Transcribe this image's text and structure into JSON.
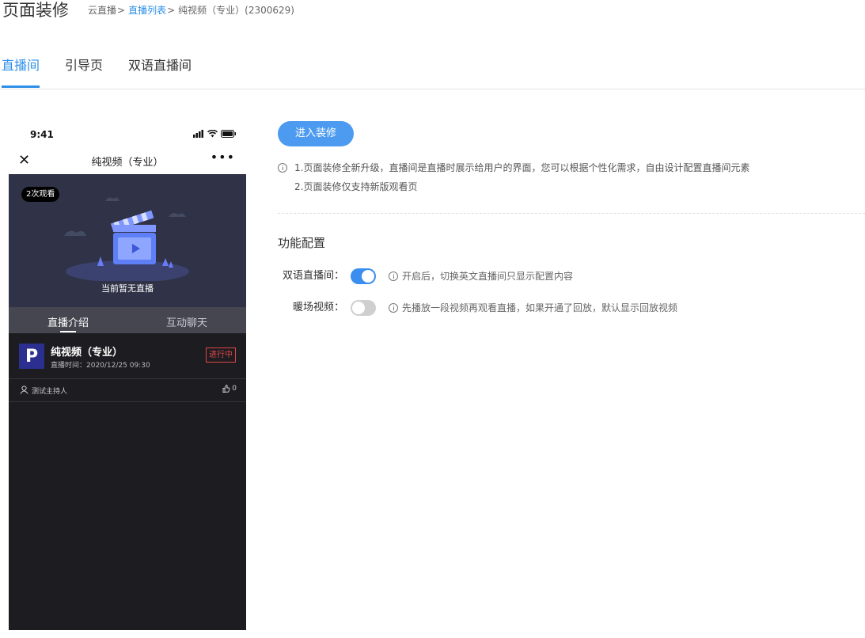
{
  "header": {
    "title": "页面装修",
    "breadcrumb": [
      {
        "label": "云直播",
        "link": false
      },
      {
        "label": "直播列表",
        "link": true
      },
      {
        "label": "纯视频（专业）(2300629)",
        "link": false
      }
    ],
    "separator": ">"
  },
  "tabs": [
    {
      "label": "直播间",
      "active": true
    },
    {
      "label": "引导页",
      "active": false
    },
    {
      "label": "双语直播间",
      "active": false
    }
  ],
  "phone": {
    "status_time": "9:41",
    "nav_close": "✕",
    "nav_title": "纯视频（专业）",
    "nav_more": "•••",
    "view_badge": "2次观看",
    "player_message": "当前暂无直播",
    "tabs": [
      {
        "label": "直播介绍",
        "active": true
      },
      {
        "label": "互动聊天",
        "active": false
      }
    ],
    "live": {
      "logo_letter": "P",
      "name": "纯视频（专业）",
      "time": "直播时间：2020/12/25 09:30",
      "status": "进行中"
    },
    "host": {
      "name": "测试主持人",
      "likes": "0"
    }
  },
  "panel": {
    "enter_button": "进入装修",
    "notes": [
      "1.页面装修全新升级，直播间是直播时展示给用户的界面，您可以根据个性化需求，自由设计配置直播间元素",
      "2.页面装修仅支持新版观看页"
    ],
    "section_title": "功能配置",
    "configs": [
      {
        "label": "双语直播间：",
        "enabled": true,
        "hint": "开启后，切换英文直播间只显示配置内容"
      },
      {
        "label": "暖场视频：",
        "enabled": false,
        "hint": "先播放一段视频再观看直播，如果开通了回放，默认显示回放视频"
      }
    ]
  },
  "colors": {
    "accent": "#2f8fe8",
    "button": "#4c9bf0",
    "switch_on": "#3a8ef0",
    "live_status": "#e04848"
  },
  "icons": [
    "info-icon",
    "close-icon",
    "more-icon",
    "signal-icon",
    "wifi-icon",
    "battery-icon",
    "clapperboard-icon",
    "user-icon",
    "thumbs-up-icon"
  ]
}
